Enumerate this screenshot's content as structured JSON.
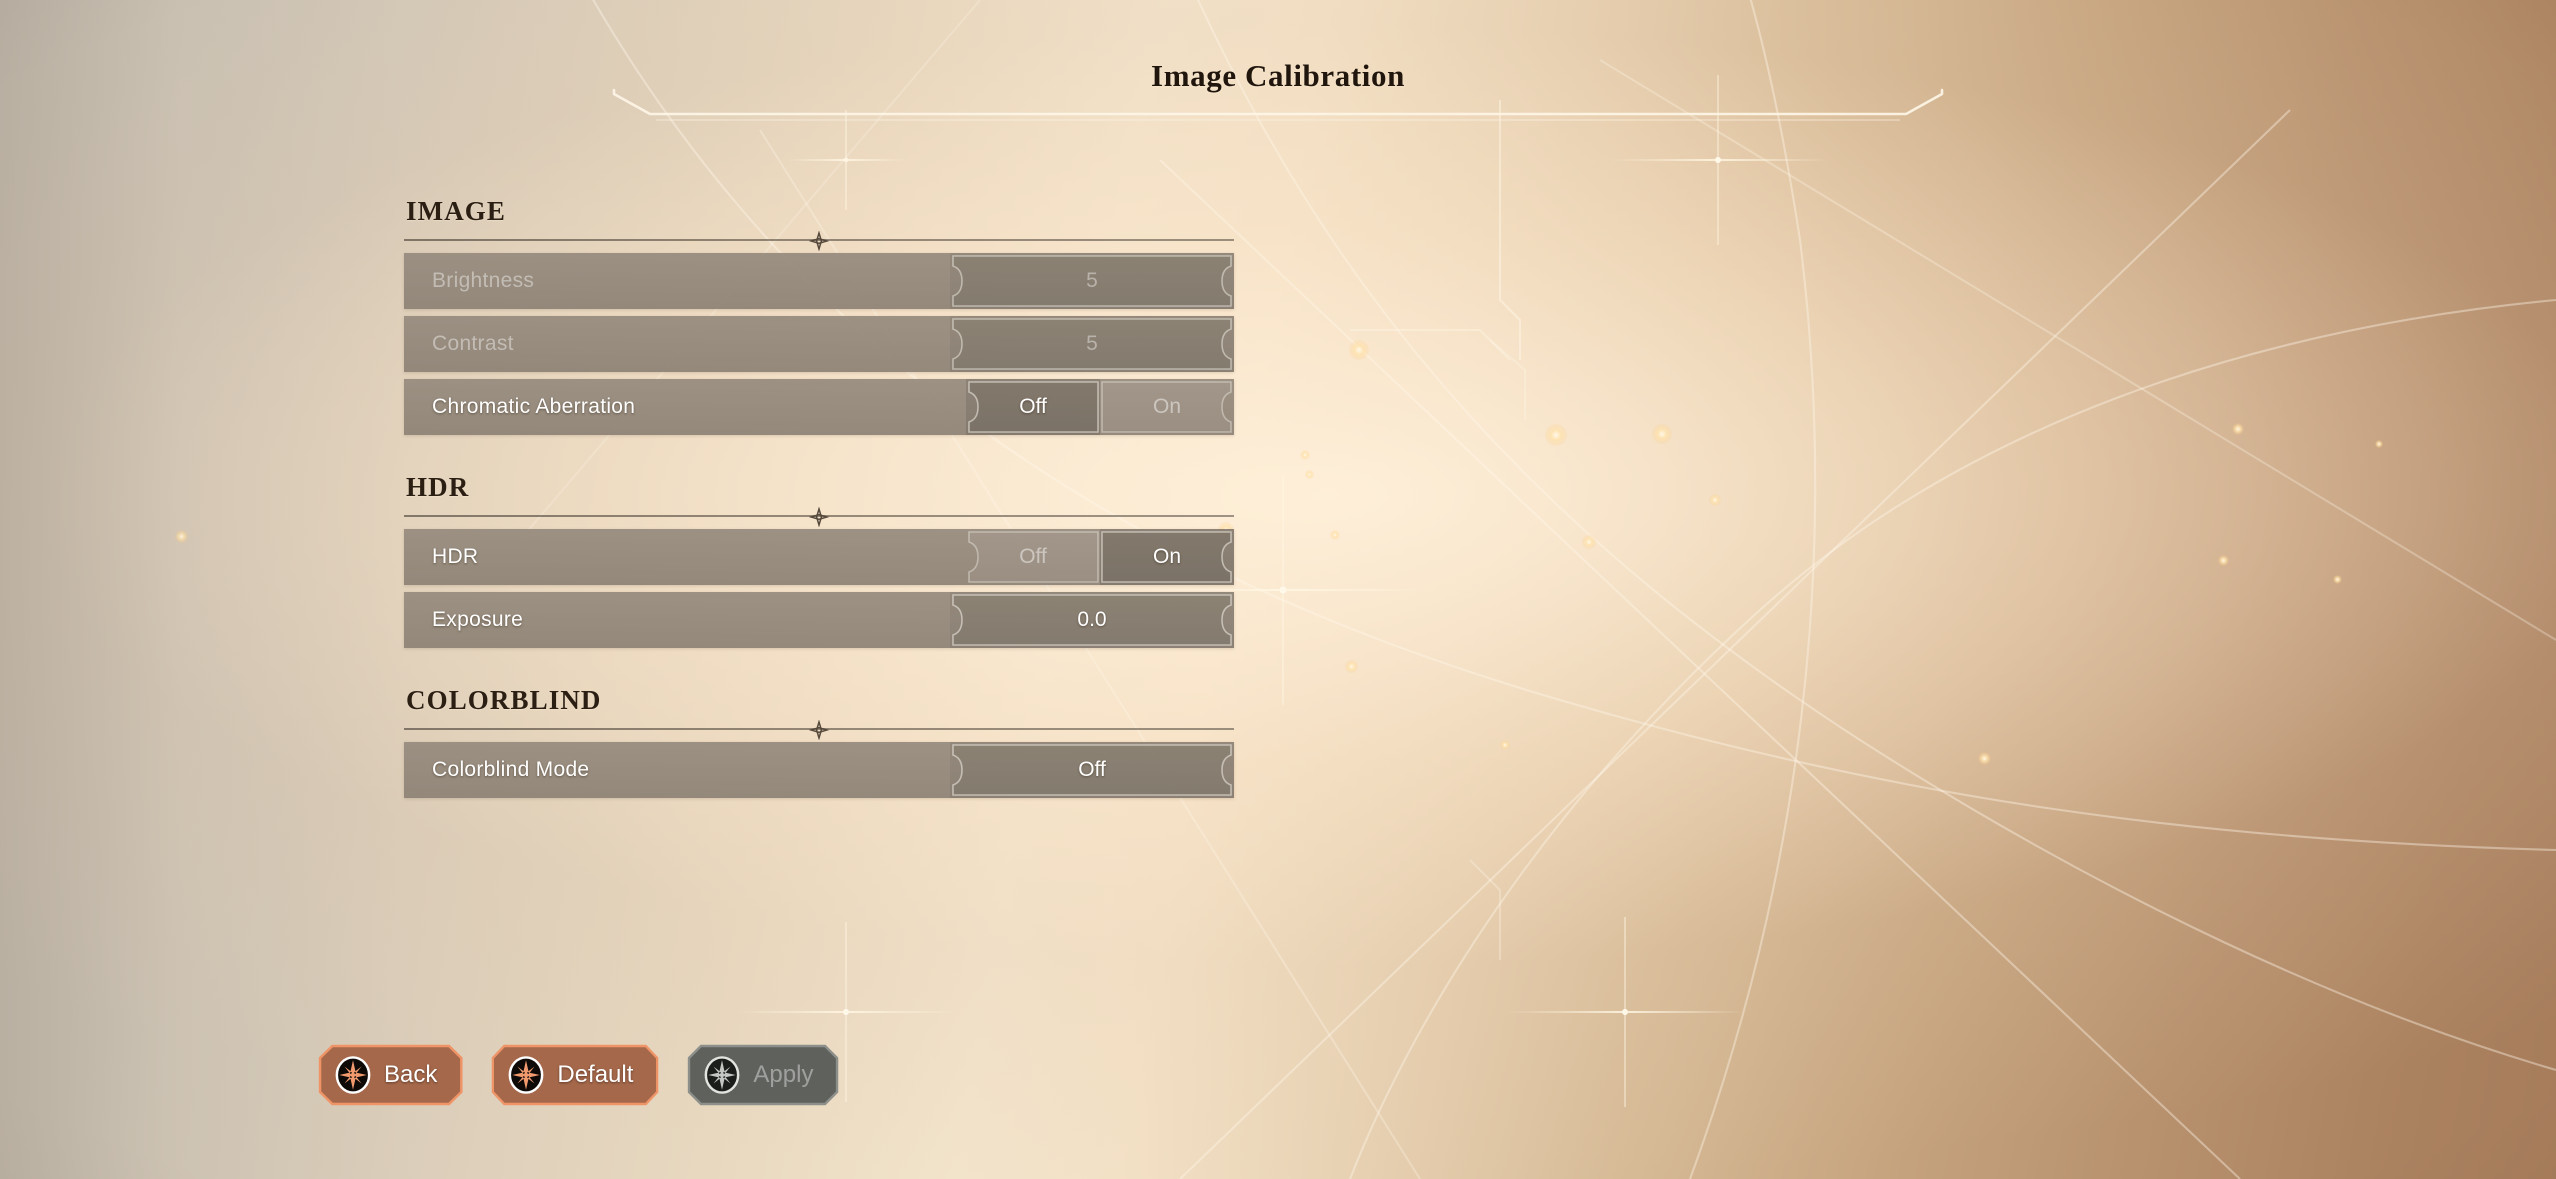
{
  "header": {
    "title": "Image Calibration"
  },
  "sections": [
    {
      "id": "image",
      "title": "IMAGE",
      "rows": [
        {
          "id": "brightness",
          "label": "Brightness",
          "type": "value",
          "value": "5",
          "disabled": true
        },
        {
          "id": "contrast",
          "label": "Contrast",
          "type": "value",
          "value": "5",
          "disabled": true
        },
        {
          "id": "chromatic-aberration",
          "label": "Chromatic Aberration",
          "type": "toggle",
          "options": [
            "Off",
            "On"
          ],
          "selected": "Off",
          "disabled": false
        }
      ]
    },
    {
      "id": "hdr",
      "title": "HDR",
      "rows": [
        {
          "id": "hdr",
          "label": "HDR",
          "type": "toggle",
          "options": [
            "Off",
            "On"
          ],
          "selected": "On",
          "disabled": false
        },
        {
          "id": "exposure",
          "label": "Exposure",
          "type": "value",
          "value": "0.0",
          "disabled": false
        }
      ]
    },
    {
      "id": "colorblind",
      "title": "COLORBLIND",
      "rows": [
        {
          "id": "colorblind-mode",
          "label": "Colorblind Mode",
          "type": "value",
          "value": "Off",
          "disabled": false
        }
      ]
    }
  ],
  "footer": {
    "buttons": [
      {
        "id": "back",
        "label": "Back",
        "icon": "compass-rose-icon",
        "style": "primary",
        "disabled": false
      },
      {
        "id": "default",
        "label": "Default",
        "icon": "compass-rose-icon",
        "style": "primary",
        "disabled": false
      },
      {
        "id": "apply",
        "label": "Apply",
        "icon": "compass-rose-icon",
        "style": "disabled",
        "disabled": true
      }
    ]
  },
  "colors": {
    "accent_orange": "#e98a5c",
    "button_fill": "#a5674b",
    "button_disabled_fill": "#5e605c",
    "row_fill": "#8f8478",
    "title_text": "#20160e",
    "bg_light": "#f2e3cb",
    "bg_dark": "#a67c5b"
  }
}
